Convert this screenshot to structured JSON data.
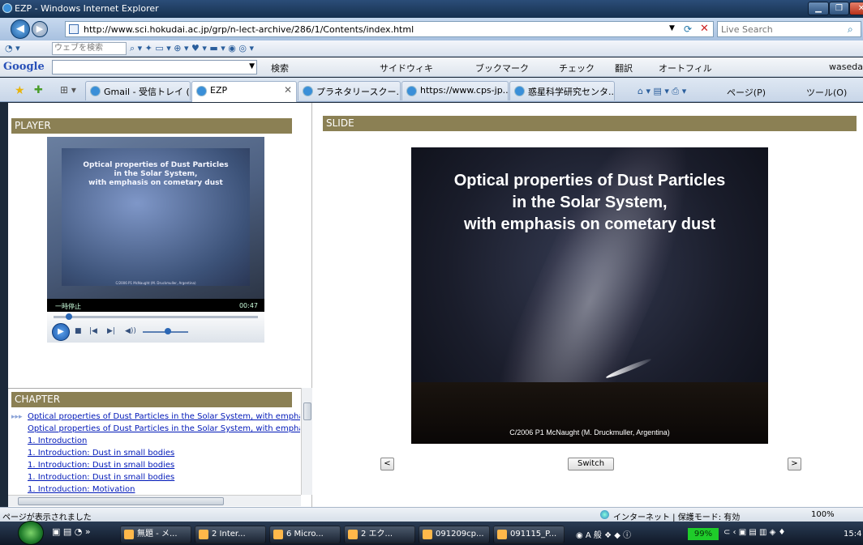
{
  "window": {
    "title": "EZP - Windows Internet Explorer"
  },
  "address": {
    "url": "http://www.sci.hokudai.ac.jp/grp/n-lect-archive/286/1/Contents/index.html",
    "search_placeholder": "Live Search"
  },
  "commandbar": {
    "search_placeholder": "ウェブを検索"
  },
  "google_toolbar": {
    "logo": "Google",
    "items": [
      "検索",
      "サイドウィキ",
      "ブックマーク",
      "チェック",
      "翻訳",
      "オートフィル",
      "waseda."
    ]
  },
  "tabs": [
    {
      "label": "Gmail - 受信トレイ (...",
      "active": false
    },
    {
      "label": "EZP",
      "active": true
    },
    {
      "label": "プラネタリースクー...",
      "active": false
    },
    {
      "label": "https://www.cps-jp...",
      "active": false
    },
    {
      "label": "惑星科学研究センタ...",
      "active": false
    }
  ],
  "tab_tools": {
    "page": "ページ(P)",
    "tools": "ツール(O)"
  },
  "player": {
    "header": "PLAYER",
    "video_title": [
      "Optical properties of Dust Particles",
      "in the Solar System,",
      "with emphasis on cometary dust"
    ],
    "video_credit": "C/2006 P1 McNaught (M. Druckmuller, Argentina)",
    "status": "一時停止",
    "time": "00:47",
    "seek_position": 0.06,
    "volume": 0.55
  },
  "slide": {
    "header": "SLIDE",
    "title_lines": [
      "Optical properties of Dust Particles",
      "in the Solar System,",
      "with emphasis on cometary dust"
    ],
    "credit": "C/2006 P1 McNaught (M. Druckmuller, Argentina)",
    "prev": "<",
    "switch": "Switch",
    "next": ">"
  },
  "chapter": {
    "header": "CHAPTER",
    "current_marker": "▸▸▸",
    "items": [
      "Optical properties of Dust Particles in the Solar System, with empha",
      "Optical properties of Dust Particles in the Solar System, with empha",
      "1. Introduction",
      "1. Introduction: Dust in small bodies",
      "1. Introduction: Dust in small bodies",
      "1. Introduction: Dust in small bodies",
      "1. Introduction: Motivation"
    ]
  },
  "statusbar": {
    "text": "ページが表示されました",
    "zone": "インターネット | 保護モード: 有効",
    "zoom": "100%"
  },
  "taskbar": {
    "buttons": [
      "無題 - メ...",
      "2 Inter...",
      "6 Micro...",
      "2 エク...",
      "091209cp...",
      "091115_P..."
    ],
    "battery": "99%",
    "clock": "15:4"
  }
}
